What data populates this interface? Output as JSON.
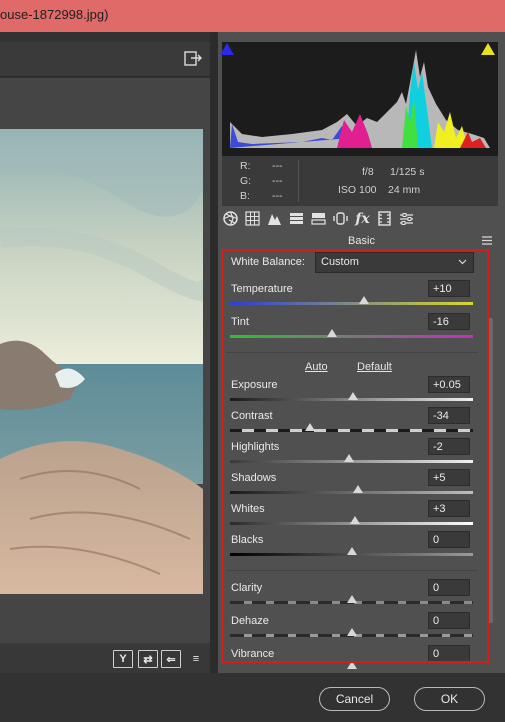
{
  "window": {
    "title": "ouse-1872998.jpg)"
  },
  "icons": {
    "export": "export-icon",
    "bottom": [
      "y-compare-icon",
      "swap-icon",
      "copy-settings-icon",
      "toggle-settings-icon"
    ],
    "tabs": [
      "basic-aperture-icon",
      "tone-curve-icon",
      "detail-icon",
      "hsl-icon",
      "split-toning-icon",
      "lens-corrections-icon",
      "effects-icon",
      "camera-calibration-icon",
      "presets-icon"
    ]
  },
  "bottom_icon_glyphs": [
    "Y",
    "⇄",
    "⇐",
    "≡"
  ],
  "readout": {
    "r_label": "R:",
    "g_label": "G:",
    "b_label": "B:",
    "r_value": "---",
    "g_value": "---",
    "b_value": "---",
    "aperture": "f/8",
    "shutter": "1/125 s",
    "iso": "ISO 100",
    "focal": "24 mm"
  },
  "panel": {
    "title": "Basic",
    "white_balance_label": "White Balance:",
    "white_balance_value": "Custom",
    "auto": "Auto",
    "default": "Default"
  },
  "sliders": {
    "temperature": {
      "label": "Temperature",
      "value": "+10",
      "level": 0.55
    },
    "tint": {
      "label": "Tint",
      "value": "-16",
      "level": 0.42
    },
    "exposure": {
      "label": "Exposure",
      "value": "+0.05",
      "level": 0.505
    },
    "contrast": {
      "label": "Contrast",
      "value": "-34",
      "level": 0.33
    },
    "highlights": {
      "label": "Highlights",
      "value": "-2",
      "level": 0.49
    },
    "shadows": {
      "label": "Shadows",
      "value": "+5",
      "level": 0.525
    },
    "whites": {
      "label": "Whites",
      "value": "+3",
      "level": 0.515
    },
    "blacks": {
      "label": "Blacks",
      "value": "0",
      "level": 0.5
    },
    "clarity": {
      "label": "Clarity",
      "value": "0",
      "level": 0.5
    },
    "dehaze": {
      "label": "Dehaze",
      "value": "0",
      "level": 0.5
    },
    "vibrance": {
      "label": "Vibrance",
      "value": "0",
      "level": 0.5
    }
  },
  "buttons": {
    "cancel": "Cancel",
    "ok": "OK"
  },
  "colors": {
    "highlight_frame": "#d81c1c",
    "title_bar": "#e06a68"
  }
}
